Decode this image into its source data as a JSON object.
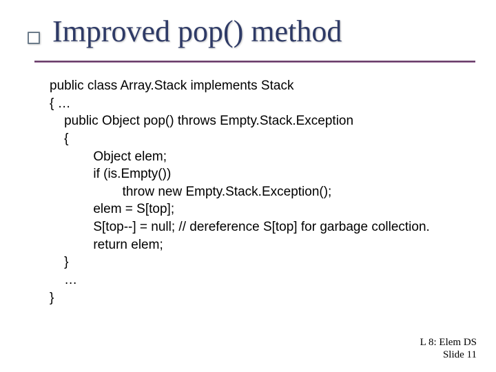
{
  "title": "Improved pop() method",
  "code": "public class Array.Stack implements Stack\n{ …\n    public Object pop() throws Empty.Stack.Exception\n    {\n            Object elem;\n            if (is.Empty())\n                    throw new Empty.Stack.Exception();\n            elem = S[top];\n            S[top--] = null; // dereference S[top] for garbage collection.\n            return elem;\n    }\n    …\n}",
  "footer": {
    "line1": "L 8: Elem DS",
    "line2": "Slide 11"
  }
}
